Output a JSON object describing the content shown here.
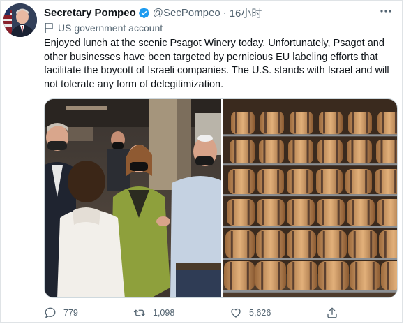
{
  "author": {
    "display_name": "Secretary Pompeo",
    "handle": "@SecPompeo",
    "time": "16小时",
    "label": "US government account",
    "verified": true
  },
  "tweet": {
    "text": "Enjoyed lunch at the scenic Psagot Winery today. Unfortunately, Psagot and other businesses have been targeted by pernicious EU labeling efforts that facilitate the boycott of Israeli companies. The U.S. stands with Israel and will not tolerate any form of delegitimization."
  },
  "media": {
    "photos": [
      {
        "description_icon": "photo-people-at-lunch"
      },
      {
        "description_icon": "photo-wine-barrels"
      }
    ]
  },
  "actions": {
    "replies": "779",
    "retweets": "1,098",
    "likes": "5,626"
  },
  "colors": {
    "text_primary": "#0f1419",
    "text_secondary": "#536471",
    "verified_blue": "#1d9bf0",
    "border": "#cfd9de"
  },
  "icons": {
    "more": "more-icon",
    "label": "flag-icon",
    "reply": "reply-icon",
    "retweet": "retweet-icon",
    "like": "like-icon",
    "share": "share-icon"
  }
}
